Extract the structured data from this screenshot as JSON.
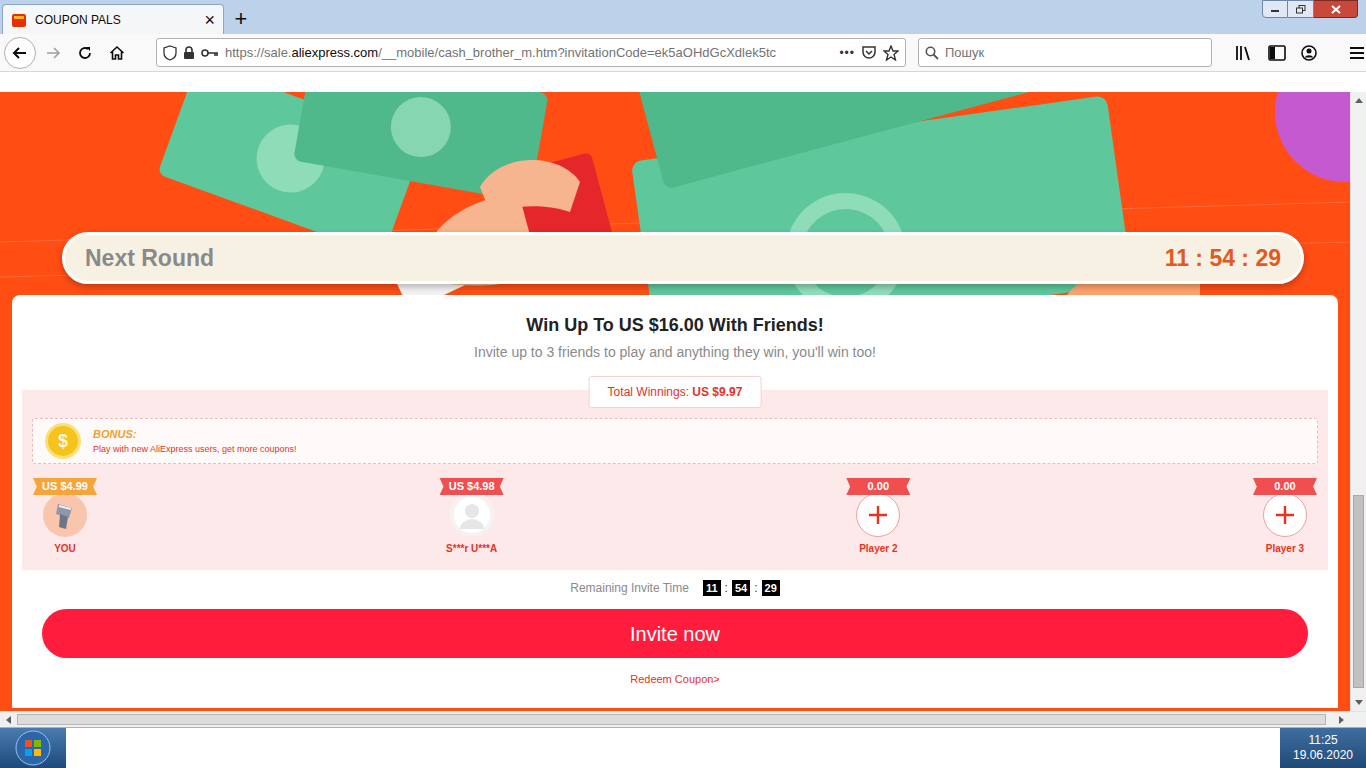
{
  "window": {
    "title": "COUPON PALS"
  },
  "tabs": [
    {
      "label": "COUPON PALS",
      "selected": true,
      "close": "×"
    }
  ],
  "new_tab": "+",
  "address_bar": {
    "url_prefix": "https://sale.",
    "url_domain": "aliexpress.com",
    "url_rest": "/__mobile/cash_brother_m.htm?invitationCode=ek5aOHdGcXdlek5tc",
    "more": "•••"
  },
  "search": {
    "placeholder": "Пошук"
  },
  "page": {
    "next_round": {
      "label": "Next Round",
      "time": "11 : 54 : 29"
    },
    "title": "Win Up To US $16.00 With Friends!",
    "subtitle": "Invite up to 3 friends to play and anything they win, you'll win too!",
    "total": {
      "label": "Total Winnings:",
      "amount": "US $9.97"
    },
    "bonus": {
      "coin": "$",
      "label": "BONUS:",
      "text": "Play with new AliExpress users, get more coupons!"
    },
    "players": [
      {
        "name": "YOU",
        "amount": "US $4.99",
        "kind": "you",
        "color": "#f5a53a"
      },
      {
        "name": "S***r U***A",
        "amount": "US $4.98",
        "kind": "friend",
        "color": "#ef4f4f"
      },
      {
        "name": "Player 2",
        "amount": "0.00",
        "kind": "empty",
        "color": "#ef4f4f"
      },
      {
        "name": "Player 3",
        "amount": "0.00",
        "kind": "empty",
        "color": "#ef4f4f"
      }
    ],
    "remaining": {
      "label": "Remaining Invite Time",
      "hours": "11",
      "minutes": "54",
      "seconds": "29",
      "separator": ":"
    },
    "invite_button": "Invite now",
    "redeem": "Redeem Coupon>"
  },
  "scrollbars": {
    "vertical": {
      "offset": 0.66,
      "size": 0.33
    },
    "horizontal": {
      "offset": 0.0,
      "size": 0.995
    }
  },
  "taskbar": {
    "time": "11:25",
    "date": "19.06.2020"
  }
}
